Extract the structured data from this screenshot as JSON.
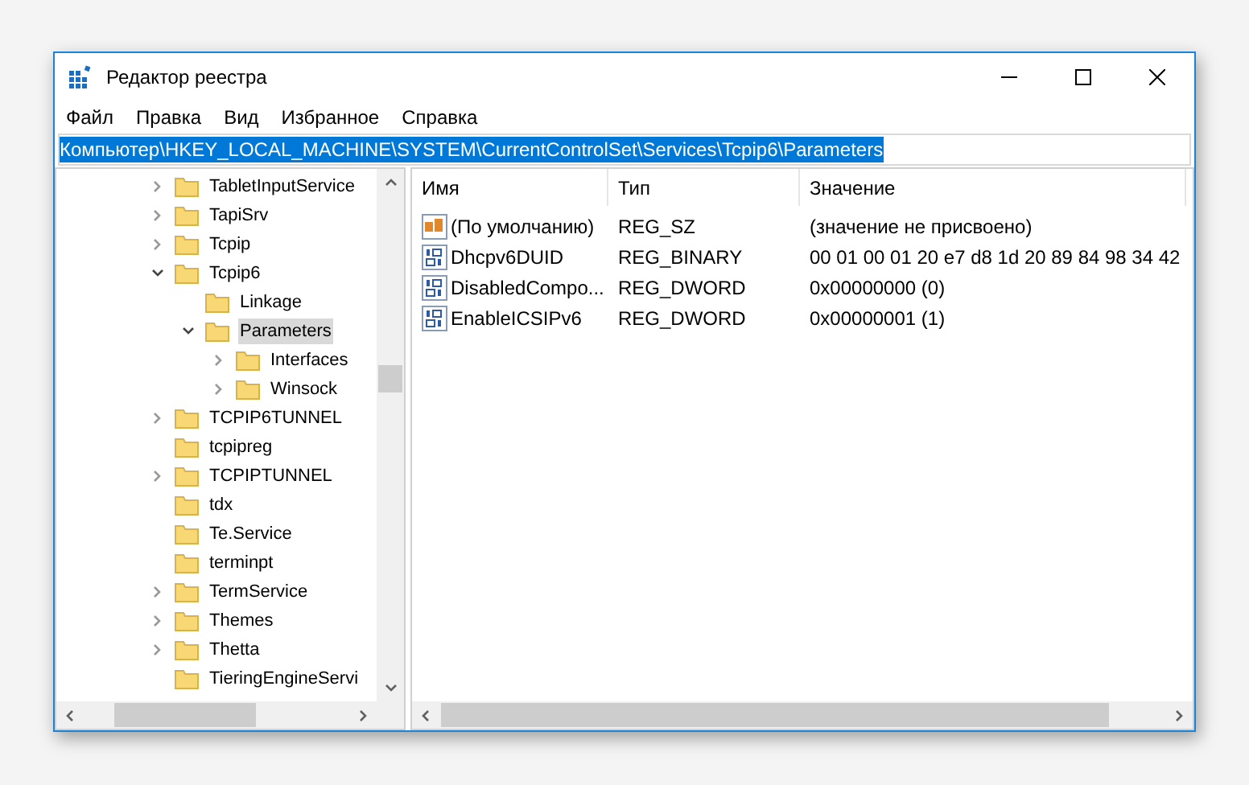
{
  "window": {
    "title": "Редактор реестра"
  },
  "menu": [
    "Файл",
    "Правка",
    "Вид",
    "Избранное",
    "Справка"
  ],
  "address": "Компьютер\\HKEY_LOCAL_MACHINE\\SYSTEM\\CurrentControlSet\\Services\\Tcpip6\\Parameters",
  "tree": [
    {
      "name": "TabletInputService",
      "kind": "branch",
      "expanded": false,
      "selected": false
    },
    {
      "name": "TapiSrv",
      "kind": "branch",
      "expanded": false,
      "selected": false
    },
    {
      "name": "Tcpip",
      "kind": "branch",
      "expanded": false,
      "selected": false
    },
    {
      "name": "Tcpip6",
      "kind": "branch",
      "expanded": true,
      "selected": false,
      "children": [
        {
          "name": "Linkage",
          "kind": "leaf",
          "selected": false
        },
        {
          "name": "Parameters",
          "kind": "branch",
          "expanded": true,
          "selected": true,
          "children": [
            {
              "name": "Interfaces",
              "kind": "branch",
              "expanded": false,
              "selected": false
            },
            {
              "name": "Winsock",
              "kind": "branch",
              "expanded": false,
              "selected": false
            }
          ]
        }
      ]
    },
    {
      "name": "TCPIP6TUNNEL",
      "kind": "branch",
      "expanded": false,
      "selected": false
    },
    {
      "name": "tcpipreg",
      "kind": "leaf",
      "selected": false
    },
    {
      "name": "TCPIPTUNNEL",
      "kind": "branch",
      "expanded": false,
      "selected": false
    },
    {
      "name": "tdx",
      "kind": "leaf",
      "selected": false
    },
    {
      "name": "Te.Service",
      "kind": "leaf",
      "selected": false
    },
    {
      "name": "terminpt",
      "kind": "leaf",
      "selected": false
    },
    {
      "name": "TermService",
      "kind": "branch",
      "expanded": false,
      "selected": false
    },
    {
      "name": "Themes",
      "kind": "branch",
      "expanded": false,
      "selected": false
    },
    {
      "name": "Thetta",
      "kind": "branch",
      "expanded": false,
      "selected": false
    },
    {
      "name": "TieringEngineServi",
      "kind": "leaf",
      "selected": false
    }
  ],
  "table": {
    "columns": [
      "Имя",
      "Тип",
      "Значение"
    ],
    "rows": [
      {
        "kind": "string",
        "name": "(По умолчанию)",
        "type": "REG_SZ",
        "value": "(значение не присвоено)"
      },
      {
        "kind": "binary",
        "name": "Dhcpv6DUID",
        "type": "REG_BINARY",
        "value": "00 01 00 01 20 e7 d8 1d 20 89 84 98 34 42"
      },
      {
        "kind": "binary",
        "name": "DisabledCompo...",
        "type": "REG_DWORD",
        "value": "0x00000000 (0)"
      },
      {
        "kind": "binary",
        "name": "EnableICSIPv6",
        "type": "REG_DWORD",
        "value": "0x00000001 (1)"
      }
    ]
  }
}
